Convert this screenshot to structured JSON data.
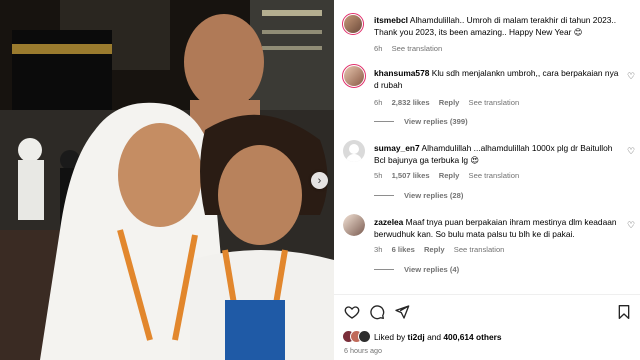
{
  "post": {
    "author": "itsmebcl",
    "caption_text": "Alhamdulillah.. Umroh di malam terakhir di tahun 2023.. Thank you 2023, its been amazing.. Happy New Year 😊",
    "time": "6h",
    "see_translation": "See translation"
  },
  "comments": [
    {
      "user": "khansuma578",
      "text": "Klu sdh menjalankn umbroh,, cara berpakaian nya d rubah",
      "time": "6h",
      "likes": "2,832 likes",
      "reply": "Reply",
      "see_translation": "See translation",
      "view_replies": "View replies (399)"
    },
    {
      "user": "sumay_en7",
      "text": "Alhamdulillah ...alhamdulillah 1000x plg dr Baitulloh Bcl bajunya ga terbuka lg 😍",
      "time": "5h",
      "likes": "1,507 likes",
      "reply": "Reply",
      "see_translation": "See translation",
      "view_replies": "View replies (28)"
    },
    {
      "user": "zazelea",
      "text": "Maaf tnya puan berpakaian ihram mestinya dlm keadaan berwudhuk kan. So bulu mata palsu tu blh ke di pakai.",
      "time": "3h",
      "likes": "6 likes",
      "reply": "Reply",
      "see_translation": "See translation",
      "view_replies": "View replies (4)"
    }
  ],
  "likes": {
    "prefix": "Liked by",
    "first_user": "ti2dj",
    "conjunction": "and",
    "count": "400,614 others"
  },
  "time_ago": "6 hours ago",
  "icons": {
    "heart": "heart-icon",
    "comment": "comment-icon",
    "share": "share-icon",
    "bookmark": "bookmark-icon",
    "carousel_next": "chevron-right-icon"
  },
  "colors": {
    "story_ring": "#e1306c",
    "meta_text": "#737373"
  }
}
